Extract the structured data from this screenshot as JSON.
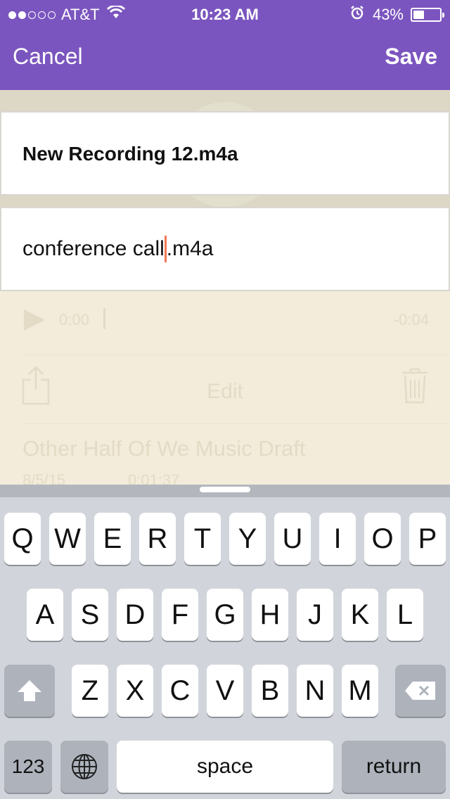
{
  "status_bar": {
    "carrier": "AT&T",
    "time": "10:23 AM",
    "battery_percent_label": "43%",
    "battery_level": 0.43,
    "signal_bars": 2
  },
  "nav": {
    "cancel_label": "Cancel",
    "save_label": "Save"
  },
  "fields": {
    "original_name": "New Recording 12.m4a",
    "new_name_before_caret": "conference call",
    "new_name_after_caret": ".m4a"
  },
  "background_player": {
    "current_time": "0:00",
    "remaining_time": "-0:04",
    "edit_label": "Edit"
  },
  "background_list": {
    "title": "Other Half Of We Music Draft",
    "date": "8/5/15",
    "duration": "0:01:37"
  },
  "keyboard": {
    "row1": [
      "Q",
      "W",
      "E",
      "R",
      "T",
      "Y",
      "U",
      "I",
      "O",
      "P"
    ],
    "row2": [
      "A",
      "S",
      "D",
      "F",
      "G",
      "H",
      "J",
      "K",
      "L"
    ],
    "row3": [
      "Z",
      "X",
      "C",
      "V",
      "B",
      "N",
      "M"
    ],
    "numbers_label": "123",
    "space_label": "space",
    "return_label": "return"
  },
  "colors": {
    "header": "#7b55bf",
    "caret": "#f07a55",
    "keyboard_bg": "#d1d5db"
  }
}
